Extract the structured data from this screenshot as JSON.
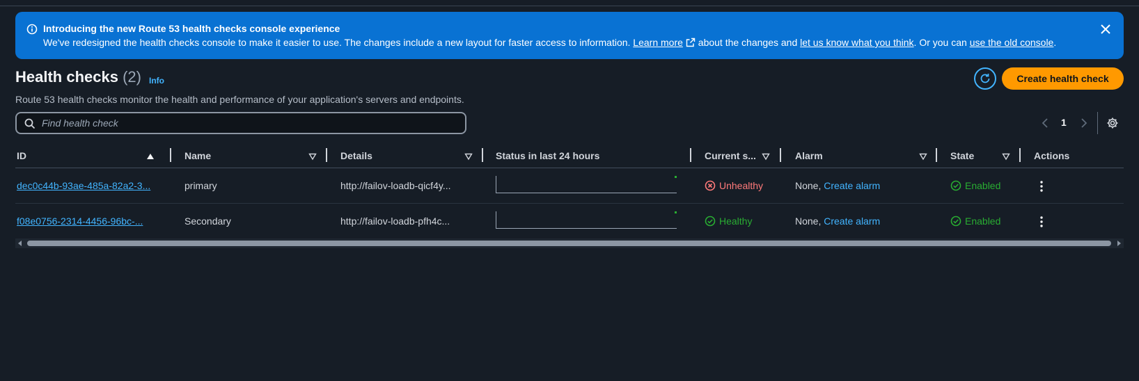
{
  "banner": {
    "title": "Introducing the new Route 53 health checks console experience",
    "text_before": "We've redesigned the health checks console to make it easier to use. The changes include a new layout for faster access to information. ",
    "learn_more": "Learn more",
    "text_middle": " about the changes and ",
    "feedback_link": "let us know what you think",
    "text_after": ". Or you can ",
    "old_console_link": "use the old console",
    "text_end": "."
  },
  "header": {
    "title": "Health checks",
    "count": "(2)",
    "info": "Info",
    "description": "Route 53 health checks monitor the health and performance of your application's servers and endpoints.",
    "create_label": "Create health check"
  },
  "search": {
    "placeholder": "Find health check"
  },
  "pagination": {
    "current_page": "1"
  },
  "table": {
    "columns": [
      "ID",
      "Name",
      "Details",
      "Status in last 24 hours",
      "Current s...",
      "Alarm",
      "State",
      "Actions"
    ],
    "rows": [
      {
        "id": "dec0c44b-93ae-485a-82a2-3...",
        "name": "primary",
        "details": "http://failov-loadb-qicf4y...",
        "current_status": "Unhealthy",
        "alarm_prefix": "None, ",
        "alarm_link": "Create alarm",
        "state": "Enabled"
      },
      {
        "id": "f08e0756-2314-4456-96bc-...",
        "name": "Secondary",
        "details": "http://failov-loadb-pfh4c...",
        "current_status": "Healthy",
        "alarm_prefix": "None, ",
        "alarm_link": "Create alarm",
        "state": "Enabled"
      }
    ]
  },
  "colors": {
    "accent": "#42b4ff",
    "primary_button": "#ff9900",
    "banner": "#0972d3",
    "healthy": "#29ad32",
    "unhealthy": "#ff7a7a"
  },
  "icons": {
    "banner": "info-icon",
    "close": "close-icon",
    "external": "external-link-icon",
    "refresh": "refresh-icon",
    "search": "search-icon",
    "settings": "gear-icon",
    "actions": "kebab-menu-icon"
  }
}
